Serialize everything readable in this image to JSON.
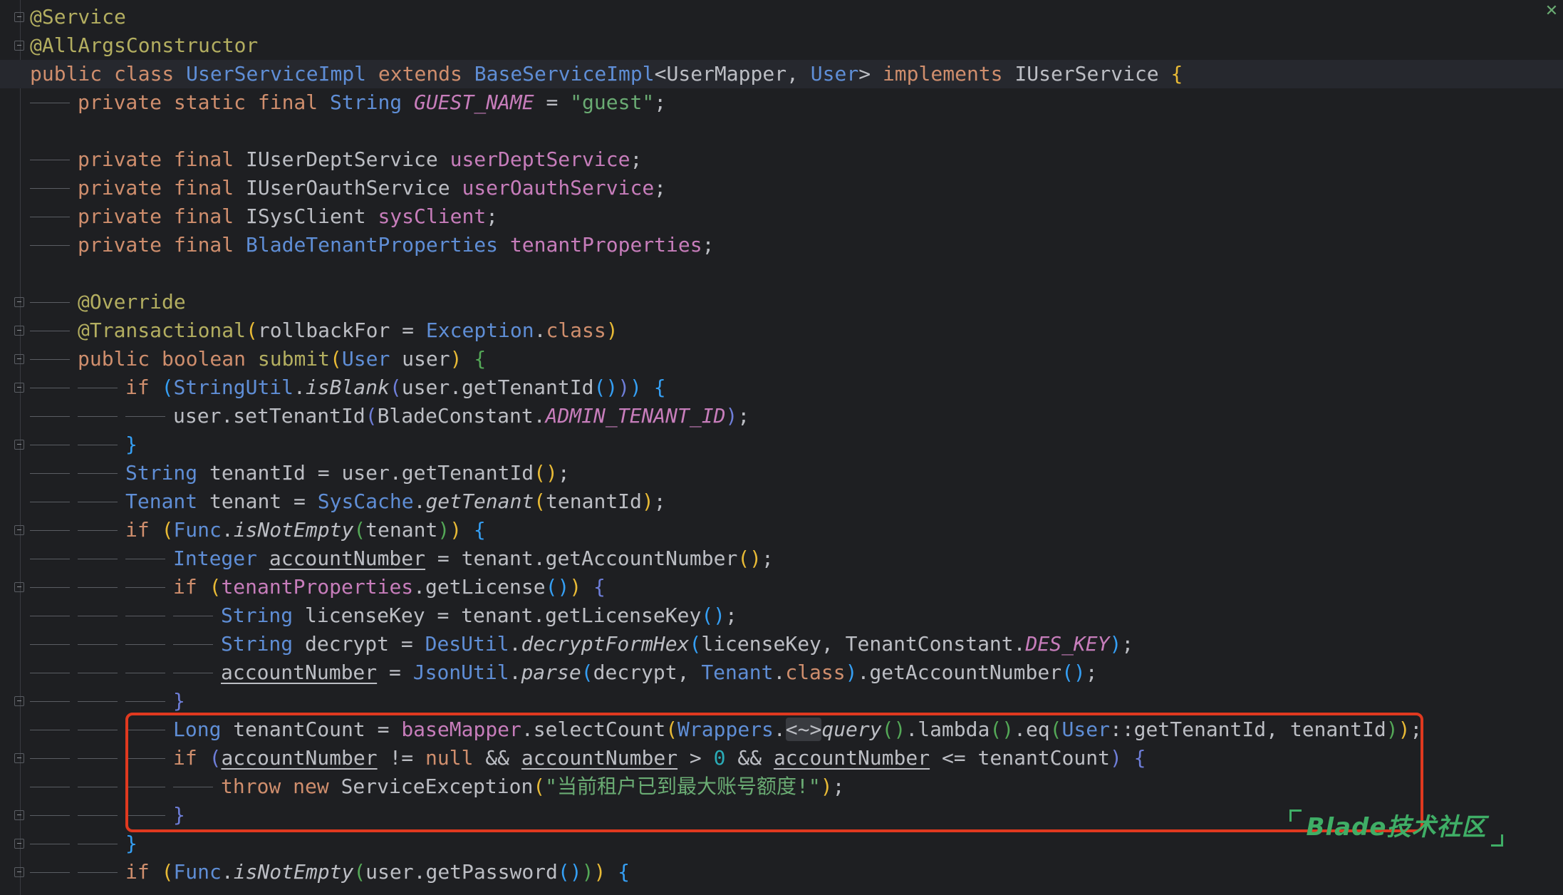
{
  "editor": {
    "watermark": "Blade技术社区"
  },
  "code": {
    "l1": "@Service",
    "l2": "@AllArgsConstructor",
    "l3": {
      "a": "public class ",
      "b": "UserServiceImpl",
      "c": " extends ",
      "d": "BaseServiceImpl",
      "e": "<UserMapper, ",
      "f": "User",
      "g": "> ",
      "h": "implements ",
      "i": "IUserService",
      "j": " {"
    },
    "l4": {
      "a": "private static final ",
      "b": "String ",
      "c": "GUEST_NAME",
      "d": " = ",
      "e": "\"guest\"",
      "f": ";"
    },
    "l6": {
      "a": "private final ",
      "b": "IUserDeptService ",
      "c": "userDeptService",
      "d": ";"
    },
    "l7": {
      "a": "private final ",
      "b": "IUserOauthService ",
      "c": "userOauthService",
      "d": ";"
    },
    "l8": {
      "a": "private final ",
      "b": "ISysClient ",
      "c": "sysClient",
      "d": ";"
    },
    "l9": {
      "a": "private final ",
      "b": "BladeTenantProperties ",
      "c": "tenantProperties",
      "d": ";"
    },
    "l11": "@Override",
    "l12": {
      "a": "@Transactional",
      "b": "(",
      "c": "rollbackFor = ",
      "d": "Exception",
      "e": ".",
      "f": "class",
      "g": ")"
    },
    "l13": {
      "a": "public boolean ",
      "b": "submit",
      "c": "(",
      "d": "User",
      "e": " user",
      "f": ")",
      "g": " {"
    },
    "l14": {
      "a": "if ",
      "b": "(",
      "c": "StringUtil",
      "d": ".",
      "e": "isBlank",
      "f": "(",
      "g": "user.getTenantId",
      "h": "()",
      "i": ")",
      "j": ")",
      "k": " {"
    },
    "l15": {
      "a": "user.setTenantId",
      "b": "(",
      "c": "BladeConstant.",
      "d": "ADMIN_TENANT_ID",
      "e": ")",
      "f": ";"
    },
    "l16": "}",
    "l17": {
      "a": "String ",
      "b": "tenantId = user.getTenantId",
      "c": "()",
      "d": ";"
    },
    "l18": {
      "a": "Tenant ",
      "b": "tenant = ",
      "c": "SysCache",
      "d": ".",
      "e": "getTenant",
      "f": "(",
      "g": "tenantId",
      "h": ")",
      "i": ";"
    },
    "l19": {
      "a": "if ",
      "b": "(",
      "c": "Func",
      "d": ".",
      "e": "isNotEmpty",
      "f": "(",
      "g": "tenant",
      "h": ")",
      "i": ")",
      "j": " {"
    },
    "l20": {
      "a": "Integer ",
      "b": "accountNumber",
      "c": " = tenant.getAccountNumber",
      "d": "()",
      "e": ";"
    },
    "l21": {
      "a": "if ",
      "b": "(",
      "c": "tenantProperties",
      "d": ".getLicense",
      "e": "()",
      "f": ")",
      "g": " {"
    },
    "l22": {
      "a": "String ",
      "b": "licenseKey = tenant.getLicenseKey",
      "c": "()",
      "d": ";"
    },
    "l23": {
      "a": "String ",
      "b": "decrypt = ",
      "c": "DesUtil",
      "d": ".",
      "e": "decryptFormHex",
      "f": "(",
      "g": "licenseKey, TenantConstant.",
      "h": "DES_KEY",
      "i": ")",
      "j": ";"
    },
    "l24": {
      "a": "accountNumber",
      "b": " = ",
      "c": "JsonUtil",
      "d": ".",
      "e": "parse",
      "f": "(",
      "g": "decrypt, ",
      "h": "Tenant",
      "i": ".",
      "j": "class",
      "k": ")",
      "l": ".getAccountNumber",
      "m": "()",
      "n": ";"
    },
    "l25": "}",
    "l26": {
      "a": "Long ",
      "b": "tenantCount = ",
      "c": "baseMapper",
      "d": ".selectCount",
      "e": "(",
      "f": "Wrappers",
      "g": ".",
      "h": "<~>",
      "i": "query",
      "j": "()",
      "k": ".lambda",
      "l": "()",
      "m": ".eq",
      "n": "(",
      "o": "User",
      "p": "::getTenantId, tenantId",
      "q": ")",
      "r": ")",
      "s": ";"
    },
    "l27": {
      "a": "if ",
      "b": "(",
      "c": "accountNumber",
      "d": " != ",
      "e": "null",
      "f": " && ",
      "g": "accountNumber",
      "h": " > ",
      "i": "0",
      "j": " && ",
      "k": "accountNumber",
      "l": " <= tenantCount",
      "m": ")",
      "n": " {"
    },
    "l28": {
      "a": "throw new ",
      "b": "ServiceException",
      "c": "(",
      "d": "\"当前租户已到最大账号额度!\"",
      "e": ")",
      "f": ";"
    },
    "l29": "}",
    "l30": "}",
    "l31": {
      "a": "if ",
      "b": "(",
      "c": "Func",
      "d": ".",
      "e": "isNotEmpty",
      "f": "(",
      "g": "user.getPassword",
      "h": "()",
      "i": ")",
      "j": ")",
      "k": " {"
    }
  }
}
